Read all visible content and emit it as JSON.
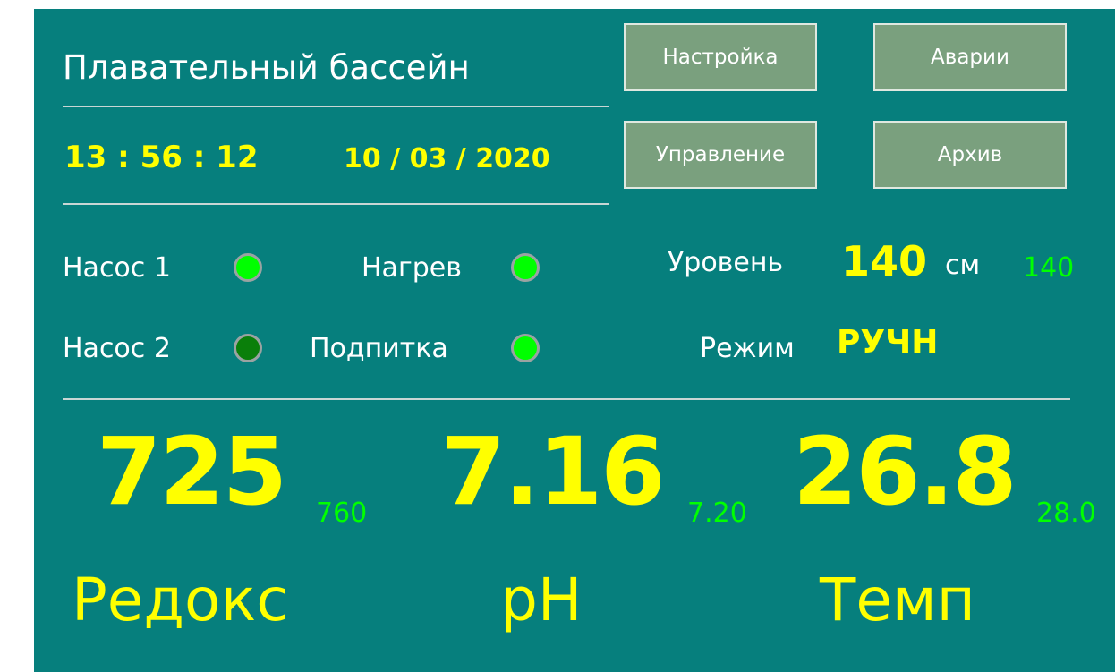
{
  "header": {
    "title": "Плавательный бассейн",
    "time": "13 : 56 : 12",
    "date": "10 / 03 / 2020"
  },
  "buttons": {
    "settings": "Настройка",
    "alarms": "Аварии",
    "control": "Управление",
    "archive": "Архив"
  },
  "status": {
    "pump1": {
      "label": "Насос 1",
      "on": true
    },
    "pump2": {
      "label": "Насос 2",
      "on": false
    },
    "heating": {
      "label": "Нагрев",
      "on": true
    },
    "refill": {
      "label": "Подпитка",
      "on": true
    }
  },
  "level": {
    "label": "Уровень",
    "value": "140",
    "unit": "см",
    "setpoint": "140"
  },
  "mode": {
    "label": "Режим",
    "value": "РУЧН"
  },
  "metrics": {
    "redox": {
      "value": "725",
      "setpoint": "760",
      "label": "Редокс"
    },
    "ph": {
      "value": "7.16",
      "setpoint": "7.20",
      "label": "pH"
    },
    "temp": {
      "value": "26.8",
      "setpoint": "28.0",
      "label": "Темп"
    }
  },
  "colors": {
    "background": "#067f7d",
    "button": "#7aa07e",
    "value": "#ffff00",
    "setpoint": "#00ff00",
    "led_on": "#00ff00",
    "led_off": "#0a7f0a"
  }
}
